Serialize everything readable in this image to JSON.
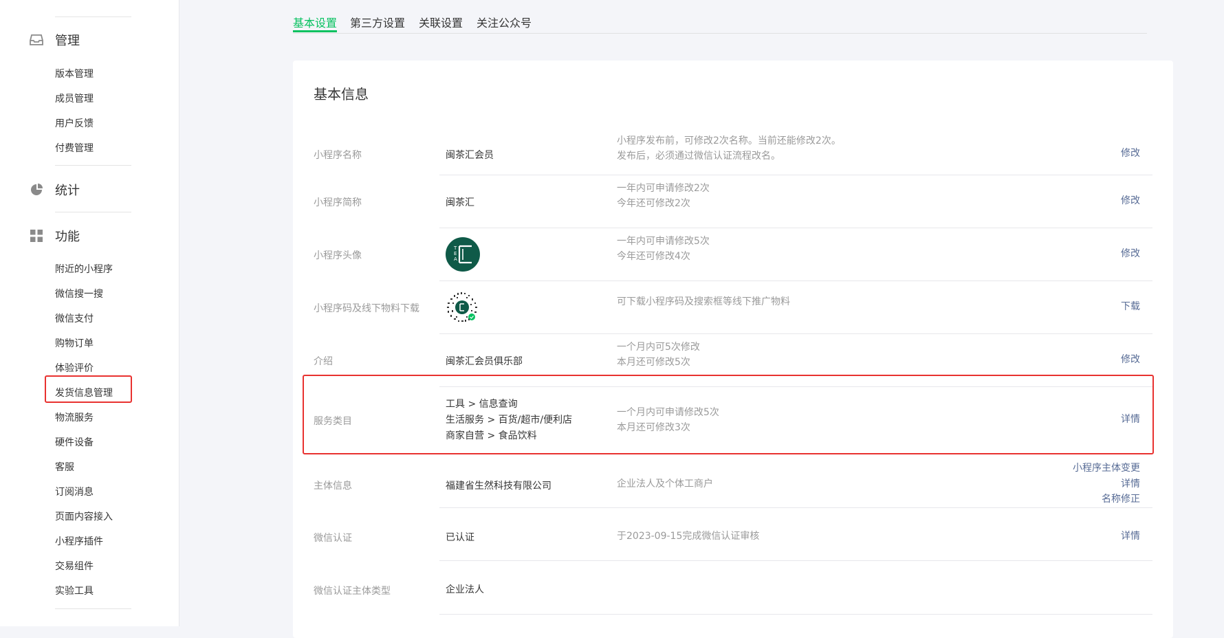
{
  "sidebar": {
    "sections": [
      {
        "label": "管理",
        "icon": "inbox-icon"
      },
      {
        "label": "统计",
        "icon": "pie-chart-icon"
      },
      {
        "label": "功能",
        "icon": "grid-icon"
      }
    ],
    "manage_items": [
      "版本管理",
      "成员管理",
      "用户反馈",
      "付费管理"
    ],
    "feature_items": [
      "附近的小程序",
      "微信搜一搜",
      "微信支付",
      "购物订单",
      "体验评价",
      "发货信息管理",
      "物流服务",
      "硬件设备",
      "客服",
      "订阅消息",
      "页面内容接入",
      "小程序插件",
      "交易组件",
      "实验工具"
    ],
    "highlighted_item": "发货信息管理"
  },
  "tabs": [
    "基本设置",
    "第三方设置",
    "关联设置",
    "关注公众号"
  ],
  "active_tab": "基本设置",
  "card": {
    "title": "基本信息",
    "rows": [
      {
        "label": "小程序名称",
        "value": "闽茶汇会员",
        "desc": [
          "小程序发布前，可修改2次名称。当前还能修改2次。",
          "发布后，必须通过微信认证流程改名。"
        ],
        "actions": [
          "修改"
        ]
      },
      {
        "label": "小程序简称",
        "value": "闽茶汇",
        "desc": [
          "一年内可申请修改2次",
          "今年还可修改2次"
        ],
        "actions": [
          "修改"
        ]
      },
      {
        "label": "小程序头像",
        "value": "",
        "desc": [
          "一年内可申请修改5次",
          "今年还可修改4次"
        ],
        "actions": [
          "修改"
        ]
      },
      {
        "label": "小程序码及线下物料下载",
        "value": "",
        "desc": [
          "可下载小程序码及搜索框等线下推广物料"
        ],
        "actions": [
          "下载"
        ]
      },
      {
        "label": "介绍",
        "value": "闽茶汇会员俱乐部",
        "desc": [
          "一个月内可5次修改",
          "本月还可修改5次"
        ],
        "actions": [
          "修改"
        ]
      },
      {
        "label": "服务类目",
        "value_lines": [
          "工具 > 信息查询",
          "生活服务 > 百货/超市/便利店",
          "商家自营 > 食品饮料"
        ],
        "desc": [
          "一个月内可申请修改5次",
          "本月还可修改3次"
        ],
        "actions": [
          "详情"
        ]
      },
      {
        "label": "主体信息",
        "value": "福建省生然科技有限公司",
        "desc": [
          "企业法人及个体工商户"
        ],
        "actions": [
          "小程序主体变更",
          "详情",
          "名称修正"
        ]
      },
      {
        "label": "微信认证",
        "value": "已认证",
        "desc": [
          "于2023-09-15完成微信认证审核"
        ],
        "actions": [
          "详情"
        ]
      },
      {
        "label": "微信认证主体类型",
        "value": "企业法人",
        "desc": [],
        "actions": []
      }
    ]
  },
  "colors": {
    "accent": "#07c160",
    "link": "#576b95",
    "highlight": "#e8312f",
    "avatar_bg": "#0f5a48"
  }
}
